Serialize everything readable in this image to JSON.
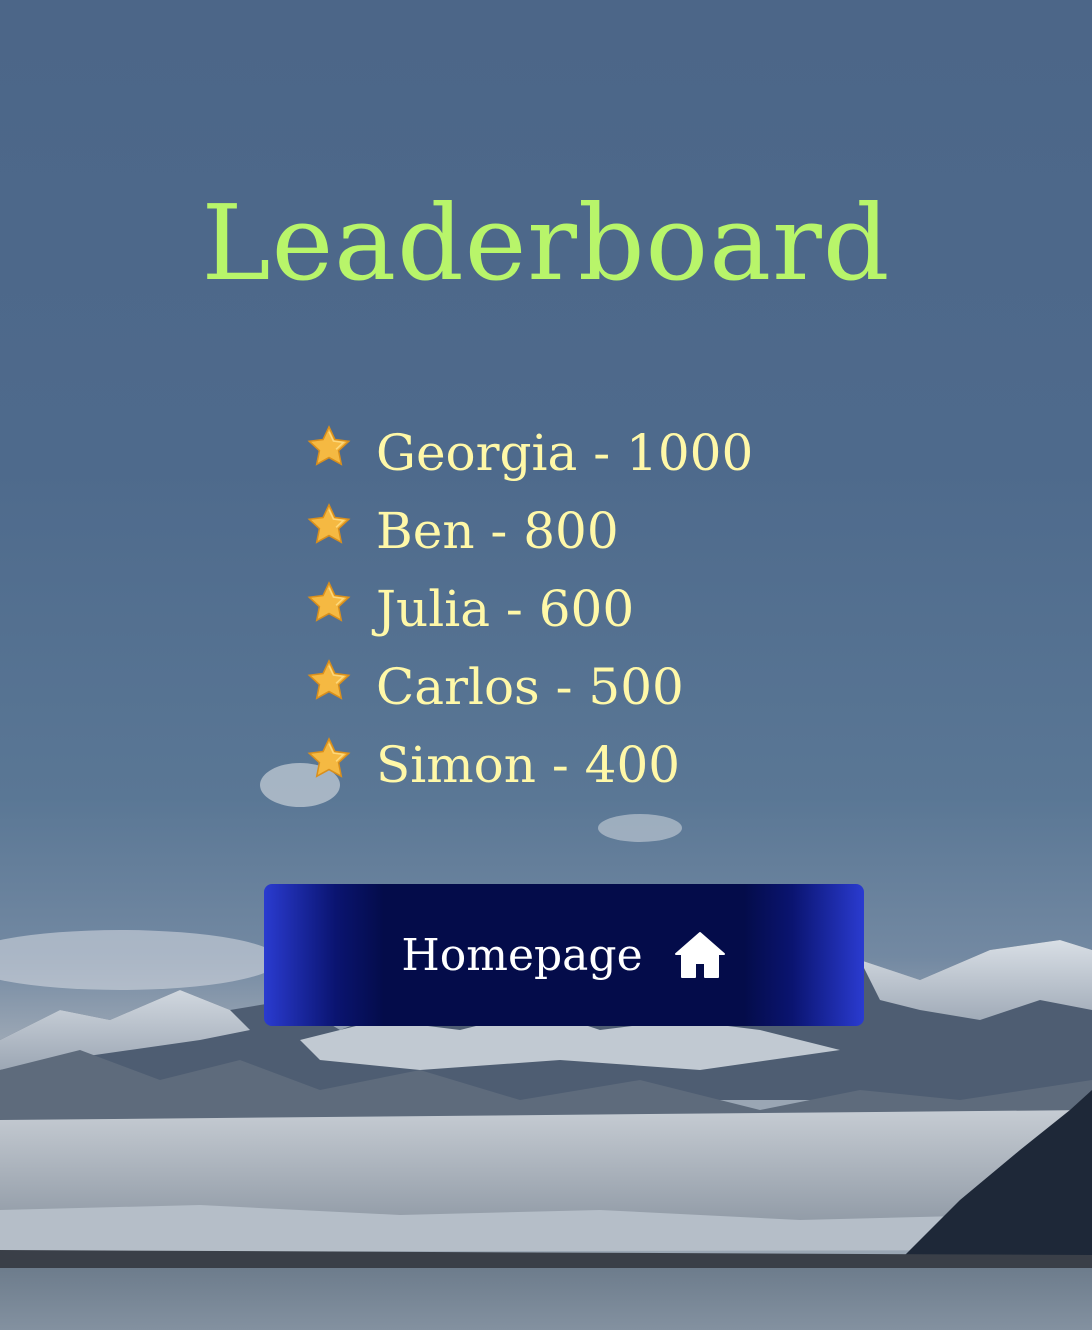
{
  "title": "Leaderboard",
  "entries": [
    {
      "text": "Georgia - 1000"
    },
    {
      "text": "Ben - 800"
    },
    {
      "text": "Julia - 600"
    },
    {
      "text": "Carlos - 500"
    },
    {
      "text": "Simon - 400"
    }
  ],
  "home_button": {
    "label": "Homepage",
    "icon": "home-icon"
  },
  "colors": {
    "title": "#b8f56a",
    "entry_text": "#fff8a8",
    "button_bg": "#040c4a",
    "button_edge": "#2a3bd0",
    "star": "#f5b942"
  },
  "background": "mountain-glacier-landscape"
}
